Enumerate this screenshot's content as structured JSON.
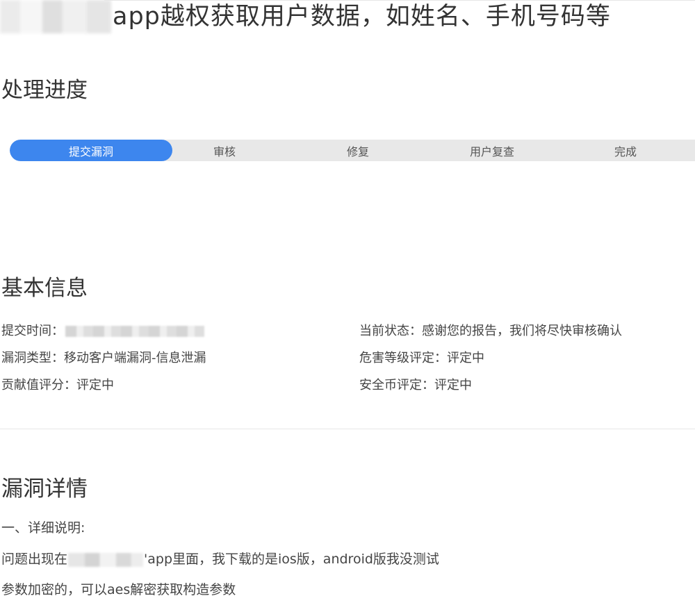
{
  "header": {
    "title": "app越权获取用户数据，如姓名、手机号码等"
  },
  "progress": {
    "title": "处理进度",
    "steps": [
      {
        "label": "提交漏洞",
        "active": true
      },
      {
        "label": "审核",
        "active": false
      },
      {
        "label": "修复",
        "active": false
      },
      {
        "label": "用户复查",
        "active": false
      },
      {
        "label": "完成",
        "active": false
      }
    ],
    "colors": {
      "active": "#3d86ee",
      "track": "#e8e8e8"
    }
  },
  "basic_info": {
    "title": "基本信息",
    "submit_time_label": "提交时间：",
    "status_label": "当前状态：",
    "status_value": "感谢您的报告，我们将尽快审核确认",
    "type_label": "漏洞类型：",
    "type_value": "移动客户端漏洞-信息泄漏",
    "severity_label": "危害等级评定：",
    "severity_value": "评定中",
    "contribution_label": "贡献值评分：",
    "contribution_value": "评定中",
    "coin_label": "安全币评定：",
    "coin_value": "评定中"
  },
  "details": {
    "title": "漏洞详情",
    "heading": "一、详细说明:",
    "line1_prefix": "问题出现在",
    "line1_suffix": "'app里面，我下载的是ios版，android版我没测试",
    "line2": "参数加密的，可以aes解密获取构造参数"
  }
}
